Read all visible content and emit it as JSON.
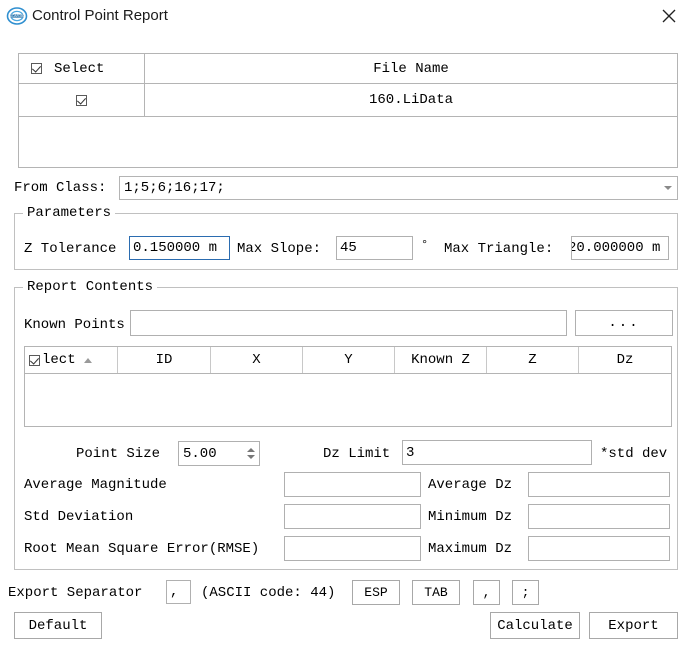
{
  "window": {
    "title": "Control Point Report",
    "logo_icon": "lidar360-logo-icon",
    "close_icon": "close-icon"
  },
  "file_table": {
    "columns": [
      "Select",
      "File Name"
    ],
    "header_checkbox_checked": true,
    "rows": [
      {
        "selected": true,
        "file_name": "160.LiData"
      }
    ]
  },
  "from_class": {
    "label": "From Class:",
    "value": "1;5;6;16;17;",
    "arrow_icon": "chevron-down-icon"
  },
  "parameters": {
    "title": "Parameters",
    "z_tolerance_label": "Z Tolerance",
    "z_tolerance_value": "0.150000 m",
    "max_slope_label": "Max Slope:",
    "max_slope_value": "45",
    "degree_symbol": "°",
    "max_triangle_label": "Max Triangle:",
    "max_triangle_value": "20.000000 m"
  },
  "report_contents": {
    "title": "Report Contents",
    "known_points_label": "Known Points",
    "known_points_value": "",
    "browse_label": "...",
    "points_table": {
      "columns": [
        "lect",
        "ID",
        "X",
        "Y",
        "Known Z",
        "Z",
        "Dz"
      ],
      "header_checkbox_checked": true,
      "sort_icon": "sort-ascending-icon",
      "rows": []
    },
    "point_size_label": "Point Size",
    "point_size_value": "5.00",
    "dz_limit_label": "Dz Limit",
    "dz_limit_value": "3",
    "std_dev_suffix": "*std dev",
    "stats": {
      "average_magnitude_label": "Average Magnitude",
      "average_magnitude_value": "",
      "average_dz_label": "Average Dz",
      "average_dz_value": "",
      "std_deviation_label": "Std Deviation",
      "std_deviation_value": "",
      "minimum_dz_label": "Minimum Dz",
      "minimum_dz_value": "",
      "rmse_label": "Root Mean Square Error(RMSE)",
      "rmse_value": "",
      "maximum_dz_label": "Maximum Dz",
      "maximum_dz_value": ""
    }
  },
  "export": {
    "separator_label": "Export Separator",
    "separator_value": ",",
    "ascii_label": "(ASCII code: 44)",
    "buttons": [
      "ESP",
      "TAB",
      ",",
      ";"
    ]
  },
  "footer": {
    "default_label": "Default",
    "calculate_label": "Calculate",
    "export_label": "Export"
  }
}
